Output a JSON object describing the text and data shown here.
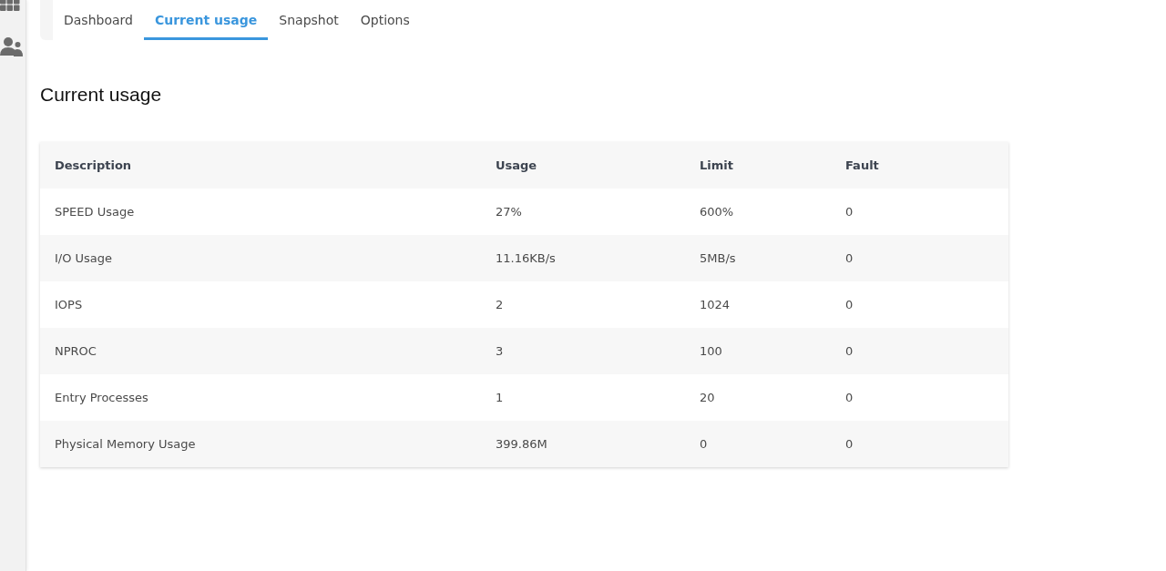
{
  "tabs": [
    {
      "label": "Dashboard",
      "selected": false
    },
    {
      "label": "Current usage",
      "selected": true
    },
    {
      "label": "Snapshot",
      "selected": false
    },
    {
      "label": "Options",
      "selected": false
    }
  ],
  "heading": "Current usage",
  "table": {
    "columns": [
      "Description",
      "Usage",
      "Limit",
      "Fault"
    ],
    "rows": [
      [
        "SPEED Usage",
        "27%",
        "600%",
        "0"
      ],
      [
        "I/O Usage",
        "11.16KB/s",
        "5MB/s",
        "0"
      ],
      [
        "IOPS",
        "2",
        "1024",
        "0"
      ],
      [
        "NPROC",
        "3",
        "100",
        "0"
      ],
      [
        "Entry Processes",
        "1",
        "20",
        "0"
      ],
      [
        "Physical Memory Usage",
        "399.86M",
        "0",
        "0"
      ]
    ]
  }
}
